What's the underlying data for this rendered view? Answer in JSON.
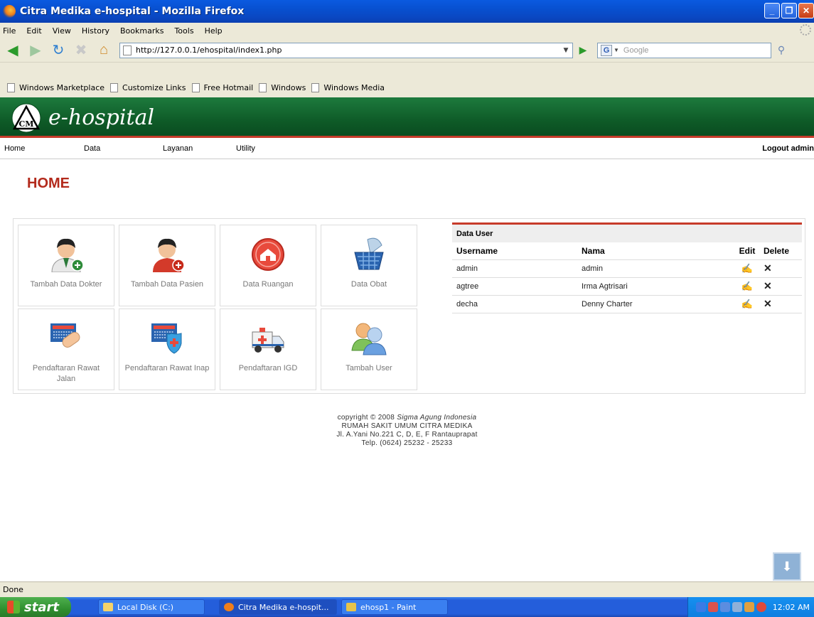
{
  "window": {
    "title": "Citra Medika e-hospital - Mozilla Firefox",
    "controls": [
      "_",
      "❐",
      "✕"
    ]
  },
  "menu": [
    "File",
    "Edit",
    "View",
    "History",
    "Bookmarks",
    "Tools",
    "Help"
  ],
  "navbar": {
    "url": "http://127.0.0.1/ehospital/index1.php",
    "search_placeholder": "Google"
  },
  "bookmarks": [
    "Windows Marketplace",
    "Customize Links",
    "Free Hotmail",
    "Windows",
    "Windows Media"
  ],
  "site": {
    "logo_text": "CM",
    "brand": "e-hospital",
    "nav": [
      "Home",
      "Data",
      "Layanan",
      "Utility"
    ],
    "logout": "Logout admin",
    "page_title": "HOME",
    "tiles": [
      {
        "label": "Tambah Data Dokter",
        "icon": "doctor-add-icon"
      },
      {
        "label": "Tambah Data Pasien",
        "icon": "patient-add-icon"
      },
      {
        "label": "Data Ruangan",
        "icon": "room-icon"
      },
      {
        "label": "Data Obat",
        "icon": "medicine-basket-icon"
      },
      {
        "label": "Pendaftaran Rawat Jalan",
        "icon": "outpatient-icon"
      },
      {
        "label": "Pendaftaran Rawat Inap",
        "icon": "inpatient-icon"
      },
      {
        "label": "Pendaftaran IGD",
        "icon": "ambulance-icon"
      },
      {
        "label": "Tambah User",
        "icon": "users-icon"
      }
    ],
    "user_table": {
      "caption": "Data User",
      "headers": [
        "Username",
        "Nama",
        "Edit",
        "Delete"
      ],
      "rows": [
        {
          "username": "admin",
          "nama": "admin"
        },
        {
          "username": "agtree",
          "nama": "Irma Agtrisari"
        },
        {
          "username": "decha",
          "nama": "Denny Charter"
        }
      ]
    },
    "footer": {
      "copyright": "copyright © 2008",
      "company": "Sigma Agung Indonesia",
      "line2": "RUMAH SAKIT UMUM CITRA MEDIKA",
      "line3": "Jl. A.Yani No.221 C, D, E, F Rantauprapat",
      "line4": "Telp. (0624) 25232 - 25233"
    }
  },
  "status": "Done",
  "taskbar": {
    "start": "start",
    "items": [
      "Local Disk (C:)",
      "Citra Medika e-hospit...",
      "ehosp1 - Paint"
    ],
    "clock": "12:02 AM"
  },
  "colors": {
    "header_green": "#0e5a27",
    "accent_red": "#b32a1c",
    "xp_blue": "#245edb"
  }
}
